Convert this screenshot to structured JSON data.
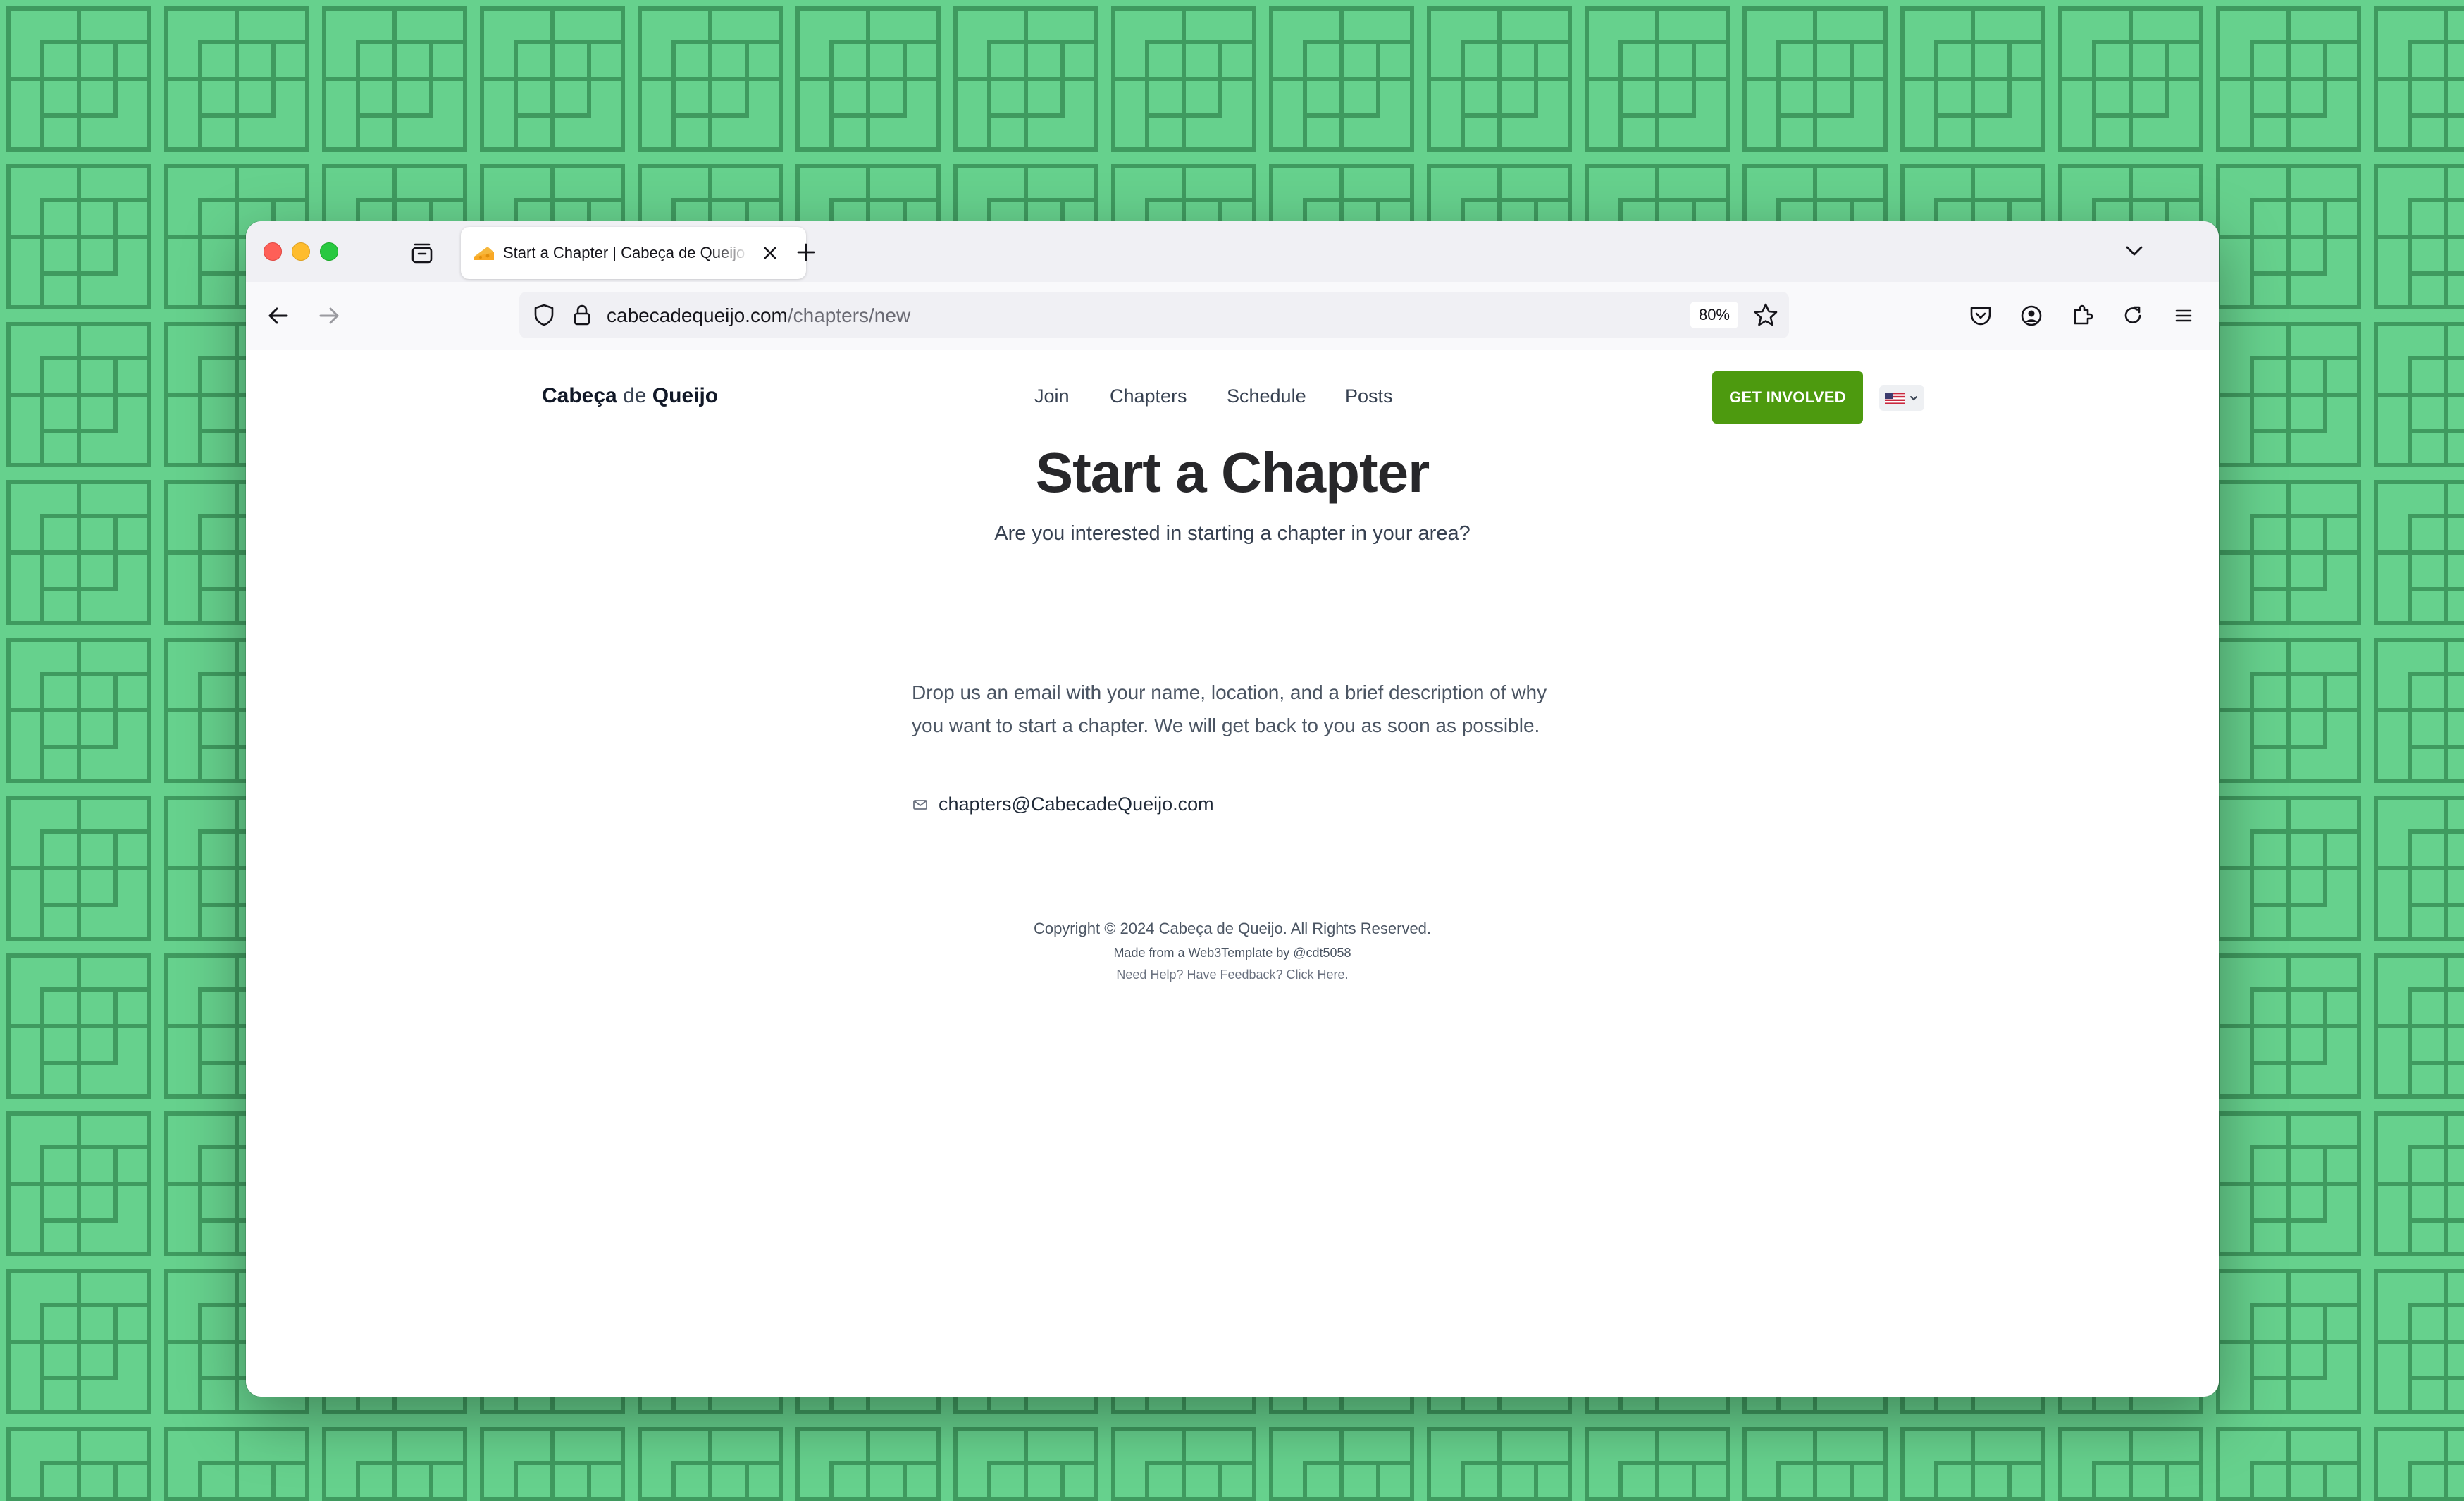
{
  "browser": {
    "tab": {
      "title": "Start a Chapter | Cabeça de Queijo",
      "favicon": "cheese-icon"
    },
    "url": {
      "domain": "cabecadequeijo.com",
      "path": "/chapters/new"
    },
    "zoom": "80%"
  },
  "site": {
    "brand": {
      "part1": "Cabeça",
      "part2": "de",
      "part3": "Queijo"
    },
    "nav": {
      "items": [
        {
          "label": "Join"
        },
        {
          "label": "Chapters"
        },
        {
          "label": "Schedule"
        },
        {
          "label": "Posts"
        }
      ]
    },
    "cta_label": "GET INVOLVED",
    "language_flag": "us-flag-icon",
    "colors": {
      "cta": "#4d9a0f",
      "desktop_bg": "#66d18d"
    }
  },
  "main": {
    "title": "Start a Chapter",
    "subtitle": "Are you interested in starting a chapter in your area?",
    "description": "Drop us an email with your name, location, and a brief description of why you want to start a chapter. We will get back to you as soon as possible.",
    "email": "chapters@CabecadeQueijo.com"
  },
  "footer": {
    "copyright": "Copyright © 2024 Cabeça de Queijo. All Rights Reserved.",
    "credit": "Made from a Web3Template by @cdt5058",
    "feedback": "Need Help? Have Feedback? Click Here."
  }
}
